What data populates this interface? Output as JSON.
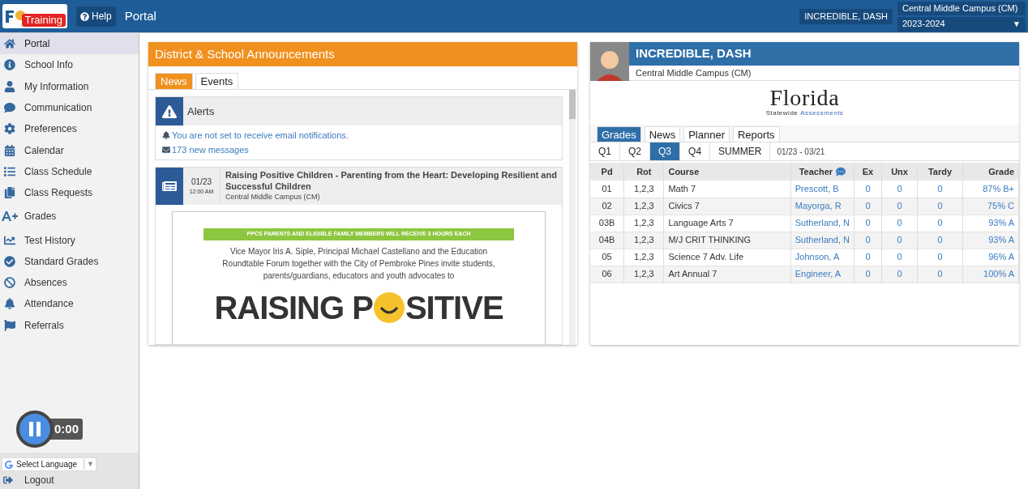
{
  "header": {
    "logo_badge": "Training",
    "help": "Help",
    "title": "Portal",
    "student_button": "INCREDIBLE, DASH",
    "school": "Central Middle Campus (CM)",
    "year": "2023-2024",
    "year_caret": "▼"
  },
  "sidebar": {
    "items": [
      {
        "label": "Portal",
        "kind": "home",
        "selected": true
      },
      {
        "label": "School Info",
        "kind": "info",
        "selected": false
      },
      {
        "label": "My Information",
        "kind": "user",
        "selected": false
      },
      {
        "label": "Communication",
        "kind": "chat",
        "selected": false
      },
      {
        "label": "Preferences",
        "kind": "gear",
        "selected": false
      },
      {
        "label": "Calendar",
        "kind": "calendar",
        "selected": false
      },
      {
        "label": "Class Schedule",
        "kind": "list",
        "selected": false
      },
      {
        "label": "Class Requests",
        "kind": "copy",
        "selected": false
      },
      {
        "label": "Grades",
        "kind": "aplus",
        "selected": false
      },
      {
        "label": "Test History",
        "kind": "chart",
        "selected": false
      },
      {
        "label": "Standard Grades",
        "kind": "check",
        "selected": false
      },
      {
        "label": "Absences",
        "kind": "ban",
        "selected": false
      },
      {
        "label": "Attendance",
        "kind": "bell",
        "selected": false
      },
      {
        "label": "Referrals",
        "kind": "flag",
        "selected": false
      }
    ],
    "recorder": {
      "time": "0:00"
    },
    "language": {
      "label": "Select Language",
      "caret": "▼"
    },
    "logout": "Logout"
  },
  "announcements": {
    "title": "District & School Announcements",
    "tabs": [
      {
        "label": "News",
        "selected": true
      },
      {
        "label": "Events",
        "selected": false
      }
    ],
    "alerts": {
      "title": "Alerts",
      "lines": [
        {
          "text": "You are not set to receive email notifications.",
          "kind": "bell"
        },
        {
          "text": "173 new messages",
          "kind": "messages"
        }
      ]
    },
    "news": {
      "date": "01/23",
      "time": "12:00 AM",
      "title": "Raising Positive Children - Parenting from the Heart: Developing Resilient and Successful Children",
      "school": "Central Middle Campus (CM)",
      "flyer": {
        "banner": "PPCS PARENTS AND ELIGIBLE FAMILY MEMBERS WILL RECEIVE 3 HOURS EACH",
        "body": "Vice Mayor Iris A. Siple, Principal Michael Castellano and the Education Roundtable Forum together with the City of Pembroke Pines invite students, parents/guardians, educators and youth advocates to",
        "heading_start": "RAISING P",
        "heading_end": "SITIVE"
      }
    }
  },
  "student": {
    "name": "INCREDIBLE, DASH",
    "school": "Central Middle Campus (CM)",
    "logo_title": "Florida",
    "logo_sub_a": "Statewide",
    "logo_sub_b": "Assessments",
    "tabs": [
      {
        "label": "Grades",
        "selected": true
      },
      {
        "label": "News",
        "selected": false
      },
      {
        "label": "Planner",
        "selected": false
      },
      {
        "label": "Reports",
        "selected": false
      }
    ],
    "terms": [
      {
        "label": "Q1",
        "selected": false
      },
      {
        "label": "Q2",
        "selected": false
      },
      {
        "label": "Q3",
        "selected": true
      },
      {
        "label": "Q4",
        "selected": false
      },
      {
        "label": "SUMMER",
        "selected": false
      }
    ],
    "term_range": "01/23 - 03/21",
    "table": {
      "columns": [
        "Pd",
        "Rot",
        "Course",
        "Teacher",
        "Ex",
        "Unx",
        "Tardy",
        "Grade"
      ],
      "rows": [
        [
          "01",
          "1,2,3",
          "Math 7",
          "Prescott, B",
          "0",
          "0",
          "0",
          "87% B+"
        ],
        [
          "02",
          "1,2,3",
          "Civics 7",
          "Mayorga, R",
          "0",
          "0",
          "0",
          "75% C"
        ],
        [
          "03B",
          "1,2,3",
          "Language Arts 7",
          "Sutherland, N",
          "0",
          "0",
          "0",
          "93% A"
        ],
        [
          "04B",
          "1,2,3",
          "M/J CRIT THINKING",
          "Sutherland, N",
          "0",
          "0",
          "0",
          "93% A"
        ],
        [
          "05",
          "1,2,3",
          "Science 7 Adv. Life",
          "Johnson, A",
          "0",
          "0",
          "0",
          "96% A"
        ],
        [
          "06",
          "1,2,3",
          "Art Annual 7",
          "Engineer, A",
          "0",
          "0",
          "0",
          "100% A"
        ]
      ]
    }
  }
}
